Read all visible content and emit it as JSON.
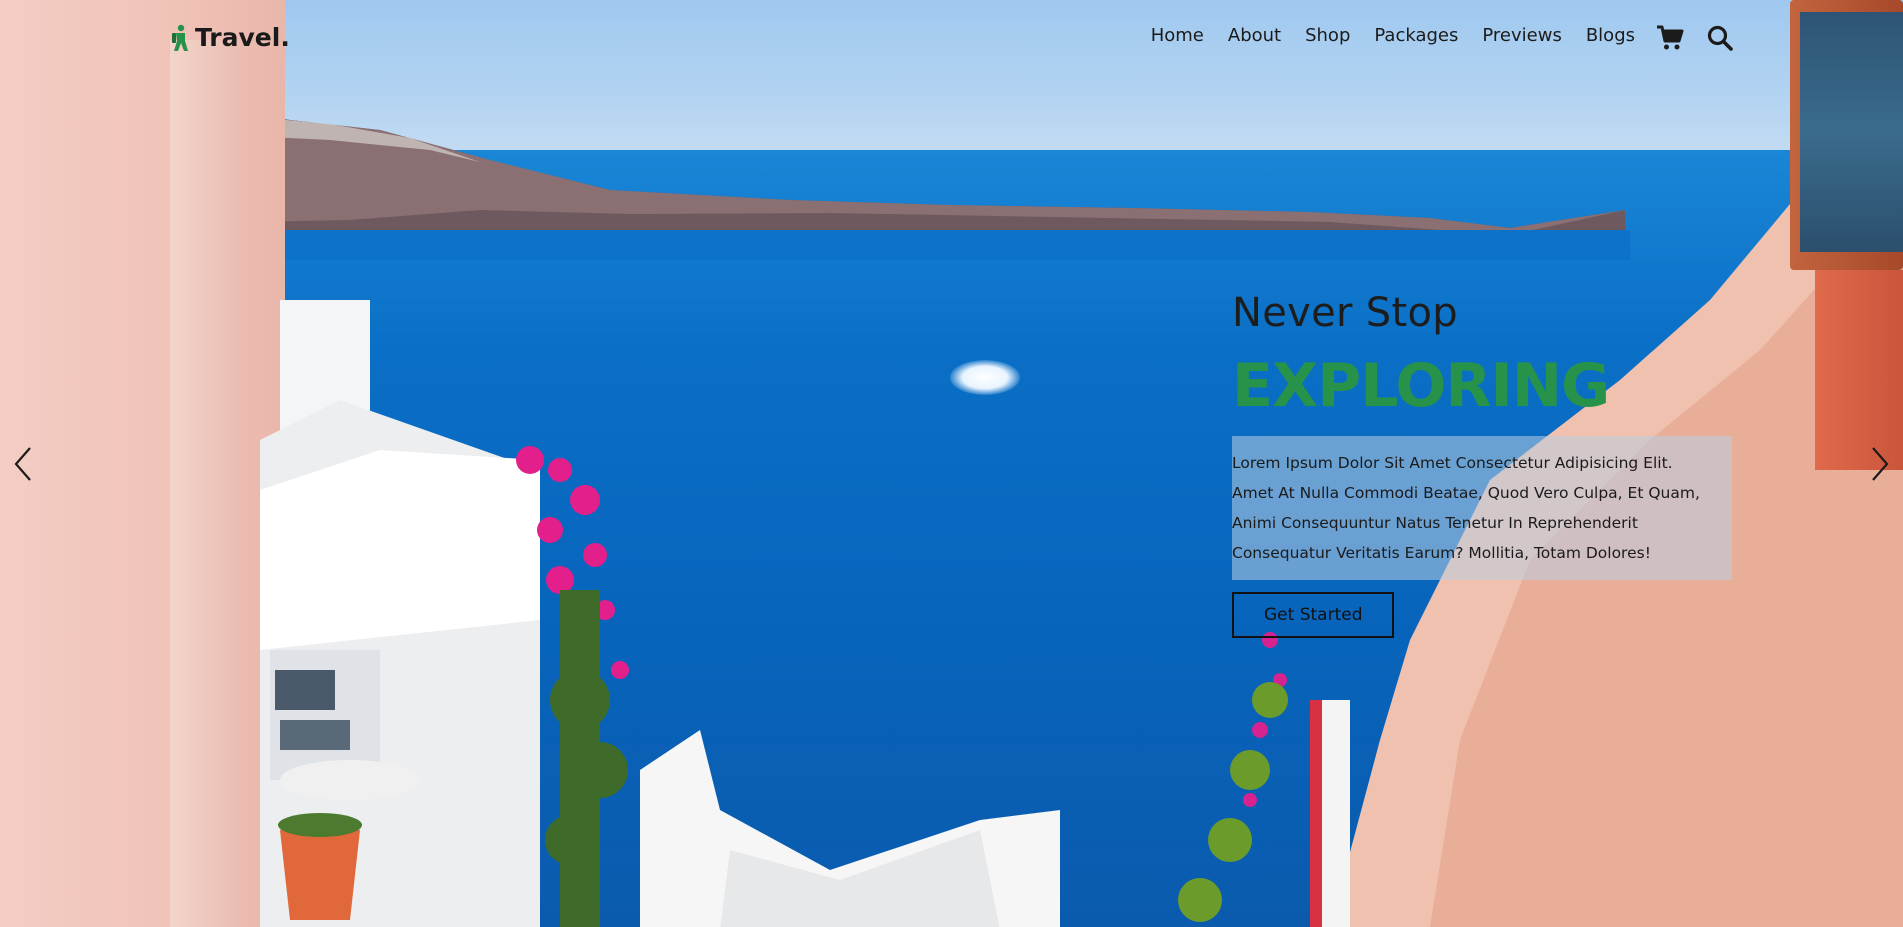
{
  "brand": {
    "name": "Travel.",
    "icon": "hiker-icon",
    "accent_color": "#27924a"
  },
  "nav": {
    "items": [
      "Home",
      "About",
      "Shop",
      "Packages",
      "Previews",
      "Blogs"
    ],
    "icons": [
      "cart-icon",
      "search-icon"
    ]
  },
  "hero": {
    "subtitle": "Never Stop",
    "title": "EXPLORING",
    "body": "Lorem Ipsum Dolor Sit Amet Consectetur Adipisicing Elit. Amet At Nulla Commodi Beatae, Quod Vero Culpa, Et Quam, Animi Consequuntur Natus Tenetur In Reprehenderit Consequatur Veritatis Earum? Mollitia, Totam Dolores!",
    "cta_label": "Get Started"
  },
  "slider": {
    "prev_icon": "chevron-left-icon",
    "next_icon": "chevron-right-icon"
  },
  "colors": {
    "title": "#27924a",
    "text": "#1b1b1b",
    "sea": "#0a6fc6"
  }
}
